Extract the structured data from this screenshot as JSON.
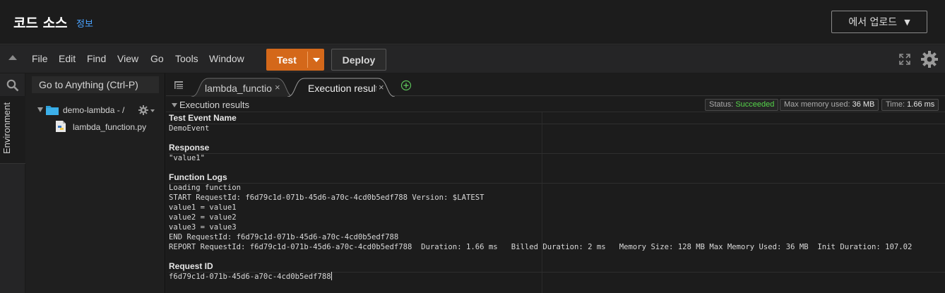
{
  "header": {
    "title": "코드 소스",
    "info_link": "정보",
    "upload_button": "에서 업로드"
  },
  "menubar": {
    "items": [
      "File",
      "Edit",
      "Find",
      "View",
      "Go",
      "Tools",
      "Window"
    ],
    "test_label": "Test",
    "deploy_label": "Deploy"
  },
  "sidebar": {
    "environment_tab": "Environment",
    "goto_placeholder": "Go to Anything (Ctrl-P)"
  },
  "file_tree": {
    "root": "demo-lambda - /",
    "files": [
      "lambda_function.py"
    ]
  },
  "tabs": [
    {
      "label": "lambda_function",
      "active": false
    },
    {
      "label": "Execution results",
      "active": true
    }
  ],
  "results": {
    "header": "Execution results",
    "status_label": "Status:",
    "status_value": "Succeeded",
    "memory_label": "Max memory used:",
    "memory_value": "36 MB",
    "time_label": "Time:",
    "time_value": "1.66 ms",
    "sections": {
      "event_name_title": "Test Event Name",
      "event_name_value": "DemoEvent",
      "response_title": "Response",
      "response_value": "\"value1\"",
      "logs_title": "Function Logs",
      "log_lines": [
        "Loading function",
        "START RequestId: f6d79c1d-071b-45d6-a70c-4cd0b5edf788 Version: $LATEST",
        "value1 = value1",
        "value2 = value2",
        "value3 = value3",
        "END RequestId: f6d79c1d-071b-45d6-a70c-4cd0b5edf788",
        "REPORT RequestId: f6d79c1d-071b-45d6-a70c-4cd0b5edf788  Duration: 1.66 ms   Billed Duration: 2 ms   Memory Size: 128 MB Max Memory Used: 36 MB  Init Duration: 107.02"
      ],
      "request_id_title": "Request ID",
      "request_id_value": "f6d79c1d-071b-45d6-a70c-4cd0b5edf788"
    }
  },
  "colors": {
    "accent_orange": "#d4681a",
    "success_green": "#55d44a",
    "link_blue": "#4aa3ff",
    "folder_blue": "#2f9fd8"
  }
}
